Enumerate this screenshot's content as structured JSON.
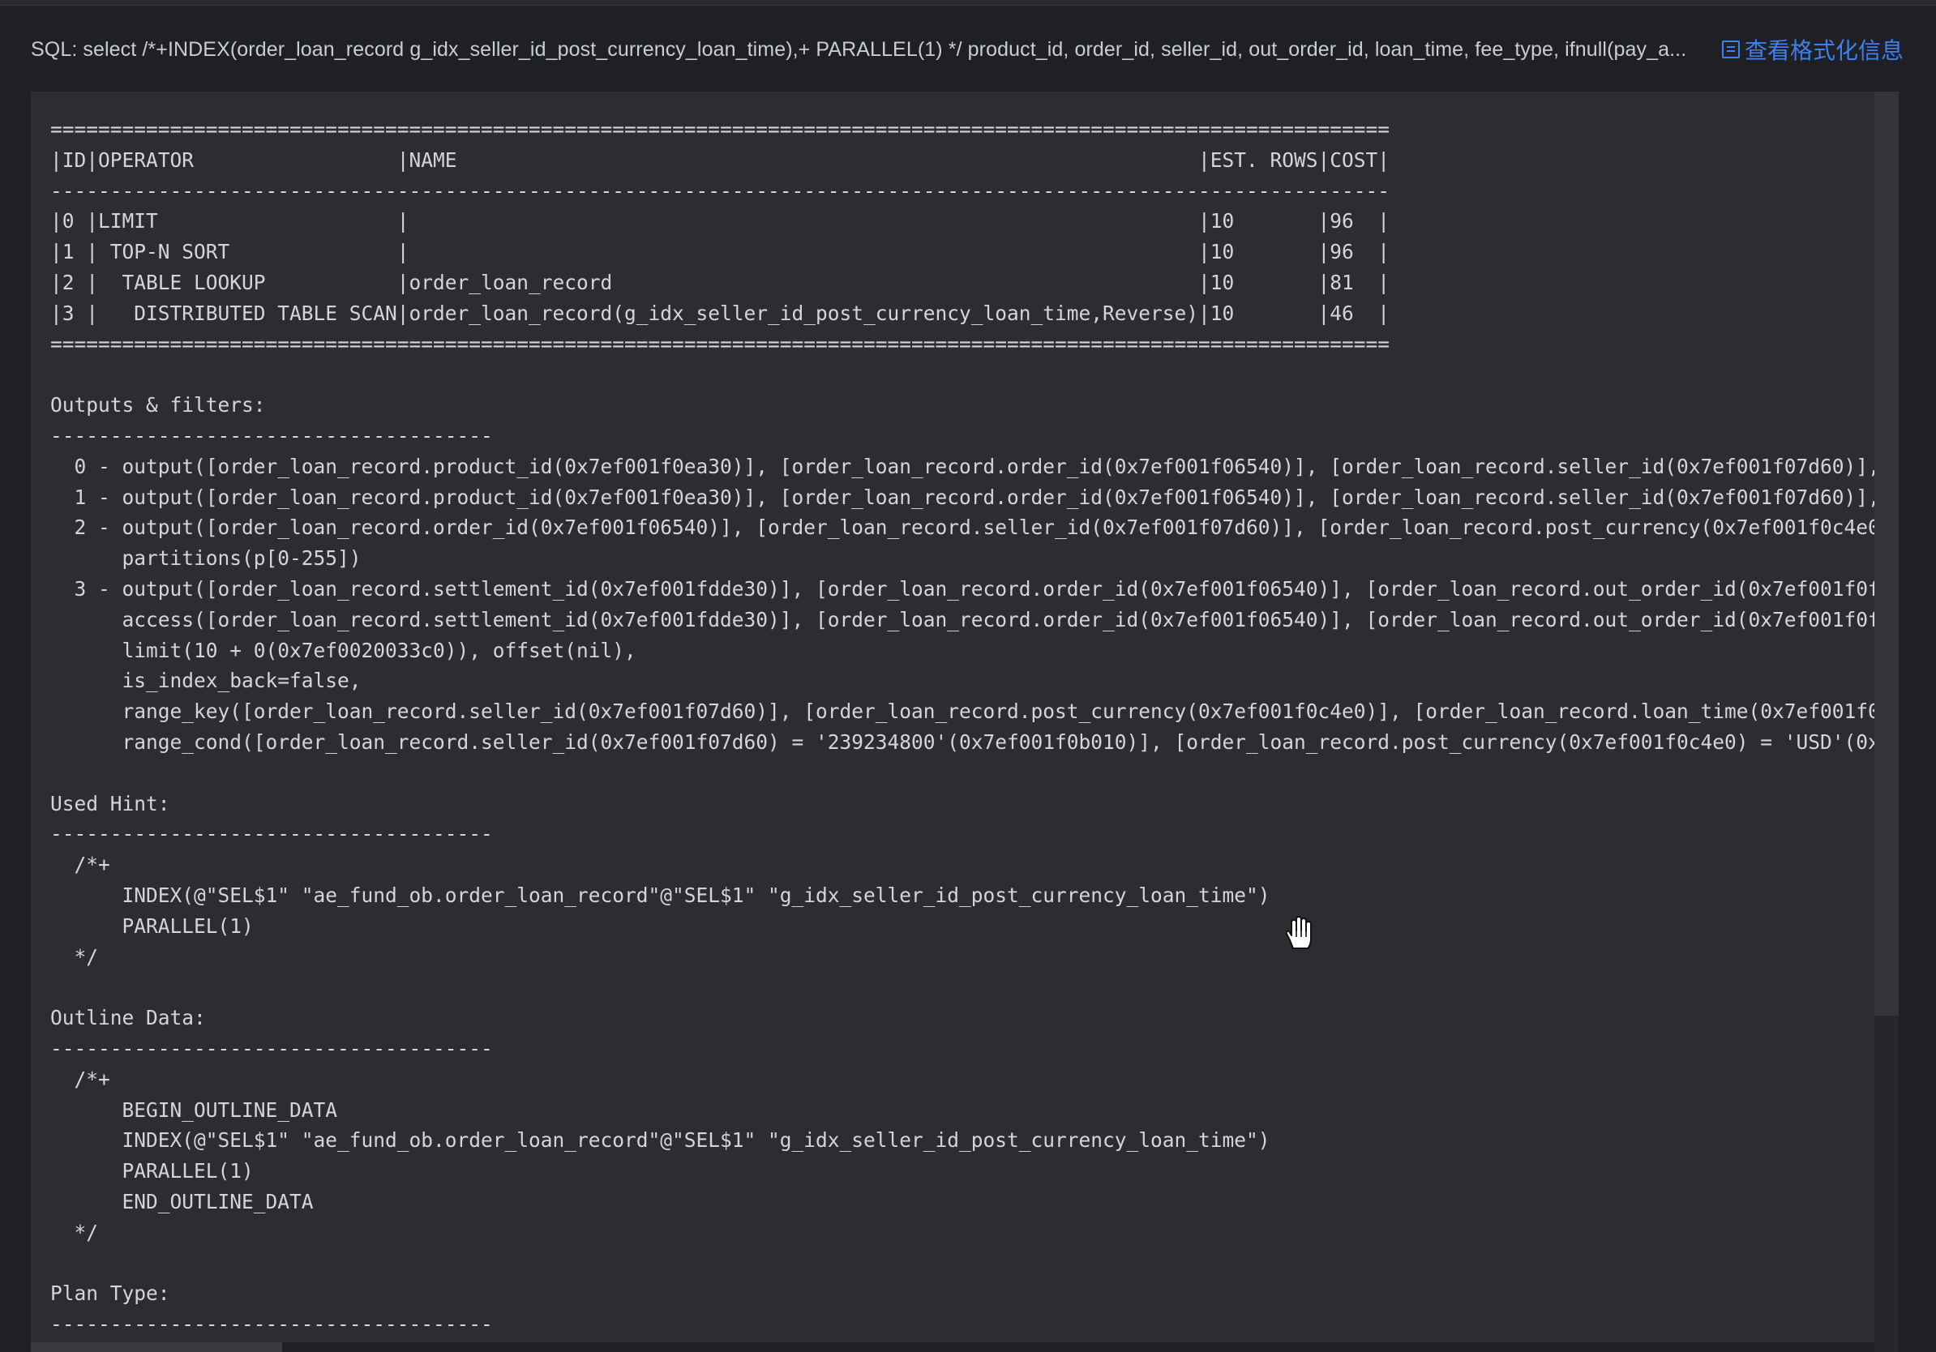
{
  "sql_bar": {
    "sql_text": "SQL: select /*+INDEX(order_loan_record g_idx_seller_id_post_currency_loan_time),+ PARALLEL(1) */ product_id, order_id, seller_id, out_order_id, loan_time, fee_type, ifnull(pay_a...",
    "format_link_label": "查看格式化信息",
    "format_icon": "format-list-icon",
    "link_color": "#3f7ff0"
  },
  "plan": {
    "text": "================================================================================================================\n|ID|OPERATOR                 |NAME                                                              |EST. ROWS|COST|\n----------------------------------------------------------------------------------------------------------------\n|0 |LIMIT                    |                                                                  |10       |96  |\n|1 | TOP-N SORT              |                                                                  |10       |96  |\n|2 |  TABLE LOOKUP           |order_loan_record                                                 |10       |81  |\n|3 |   DISTRIBUTED TABLE SCAN|order_loan_record(g_idx_seller_id_post_currency_loan_time,Reverse)|10       |46  |\n================================================================================================================\n\nOutputs & filters:\n-------------------------------------\n  0 - output([order_loan_record.product_id(0x7ef001f0ea30)], [order_loan_record.order_id(0x7ef001f06540)], [order_loan_record.seller_id(0x7ef001f07d60)], [o\n  1 - output([order_loan_record.product_id(0x7ef001f0ea30)], [order_loan_record.order_id(0x7ef001f06540)], [order_loan_record.seller_id(0x7ef001f07d60)], [o\n  2 - output([order_loan_record.order_id(0x7ef001f06540)], [order_loan_record.seller_id(0x7ef001f07d60)], [order_loan_record.post_currency(0x7ef001f0c4e0)],\n      partitions(p[0-255])\n  3 - output([order_loan_record.settlement_id(0x7ef001fdde30)], [order_loan_record.order_id(0x7ef001f06540)], [order_loan_record.out_order_id(0x7ef001f0f6c0\n      access([order_loan_record.settlement_id(0x7ef001fdde30)], [order_loan_record.order_id(0x7ef001f06540)], [order_loan_record.out_order_id(0x7ef001f0f6c0\n      limit(10 + 0(0x7ef0020033c0)), offset(nil),\n      is_index_back=false,\n      range_key([order_loan_record.seller_id(0x7ef001f07d60)], [order_loan_record.post_currency(0x7ef001f0c4e0)], [order_loan_record.loan_time(0x7ef001f0d59\n      range_cond([order_loan_record.seller_id(0x7ef001f07d60) = '239234800'(0x7ef001f0b010)], [order_loan_record.post_currency(0x7ef001f0c4e0) = 'USD'(0x7ef\n\nUsed Hint:\n-------------------------------------\n  /*+\n      INDEX(@\"SEL$1\" \"ae_fund_ob.order_loan_record\"@\"SEL$1\" \"g_idx_seller_id_post_currency_loan_time\")\n      PARALLEL(1)\n  */\n\nOutline Data:\n-------------------------------------\n  /*+\n      BEGIN_OUTLINE_DATA\n      INDEX(@\"SEL$1\" \"ae_fund_ob.order_loan_record\"@\"SEL$1\" \"g_idx_seller_id_post_currency_loan_time\")\n      PARALLEL(1)\n      END_OUTLINE_DATA\n  */\n\nPlan Type:\n-------------------------------------"
  },
  "colors": {
    "page_bg": "#1f2023",
    "panel_bg": "#2c2d31",
    "text": "#d3d5d9"
  },
  "cursor": {
    "icon": "hand-cursor-icon"
  }
}
